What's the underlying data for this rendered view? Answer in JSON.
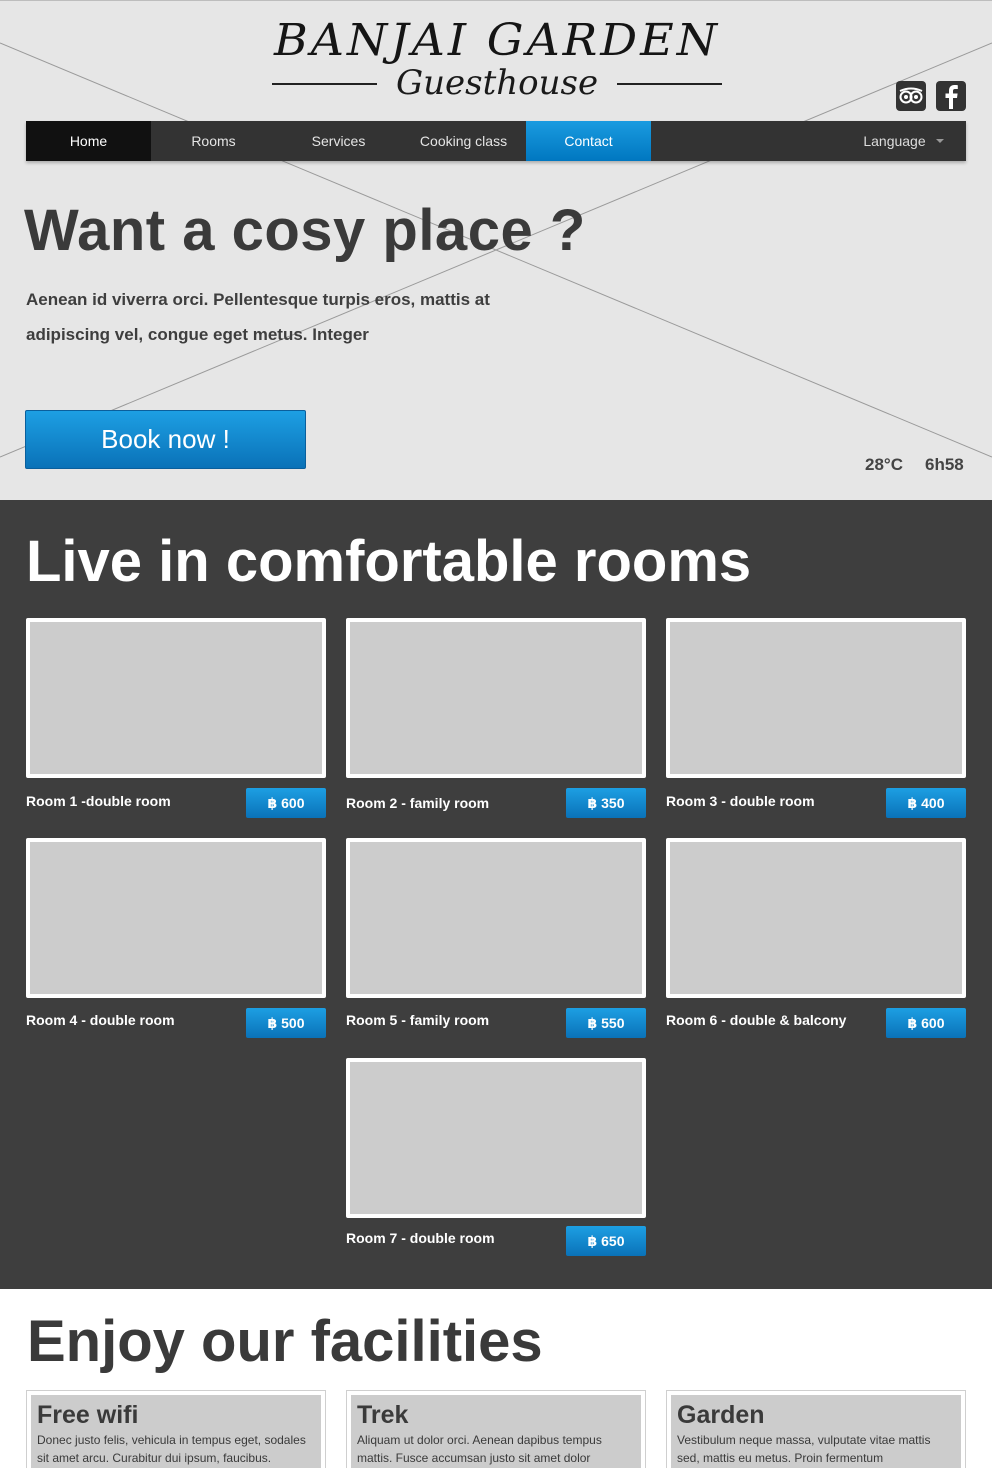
{
  "brand": {
    "title": "BANJAI GARDEN",
    "subtitle": "Guesthouse"
  },
  "nav": {
    "items": [
      "Home",
      "Rooms",
      "Services",
      "Cooking class",
      "Contact"
    ],
    "language": "Language"
  },
  "hero": {
    "title": "Want a cosy place ?",
    "text": "Aenean id viverra orci. Pellentesque turpis eros, mattis at adipiscing vel, congue eget metus. Integer",
    "cta": "Book now !",
    "temperature": "28°C",
    "time": "6h58"
  },
  "rooms": {
    "title": "Live in comfortable rooms",
    "items": [
      {
        "name": "Room 1 -double room",
        "price": "฿ 600"
      },
      {
        "name": "Room 2 - family room",
        "price": "฿ 350"
      },
      {
        "name": "Room 3 - double room",
        "price": "฿ 400"
      },
      {
        "name": "Room 4 -  double room",
        "price": "฿ 500"
      },
      {
        "name": "Room 5 - family room",
        "price": "฿ 550"
      },
      {
        "name": "Room 6 - double & balcony",
        "price": "฿ 600"
      },
      {
        "name": "Room 7 - double room",
        "price": "฿ 650"
      }
    ]
  },
  "facilities": {
    "title": "Enjoy our facilities",
    "items": [
      {
        "name": "Free wifi",
        "desc": "Donec justo felis, vehicula in tempus eget, sodales sit amet arcu. Curabitur dui ipsum, faucibus."
      },
      {
        "name": "Trek",
        "desc": "Aliquam ut dolor orci. Aenean dapibus tempus mattis. Fusce accumsan justo sit amet dolor"
      },
      {
        "name": "Garden",
        "desc": "Vestibulum neque massa, vulputate vitae mattis sed, mattis eu metus. Proin fermentum"
      }
    ]
  },
  "colors": {
    "accent": "#0a86d0",
    "dark": "#3e3e3e",
    "nav": "#333333",
    "placeholder": "#cccccc"
  }
}
